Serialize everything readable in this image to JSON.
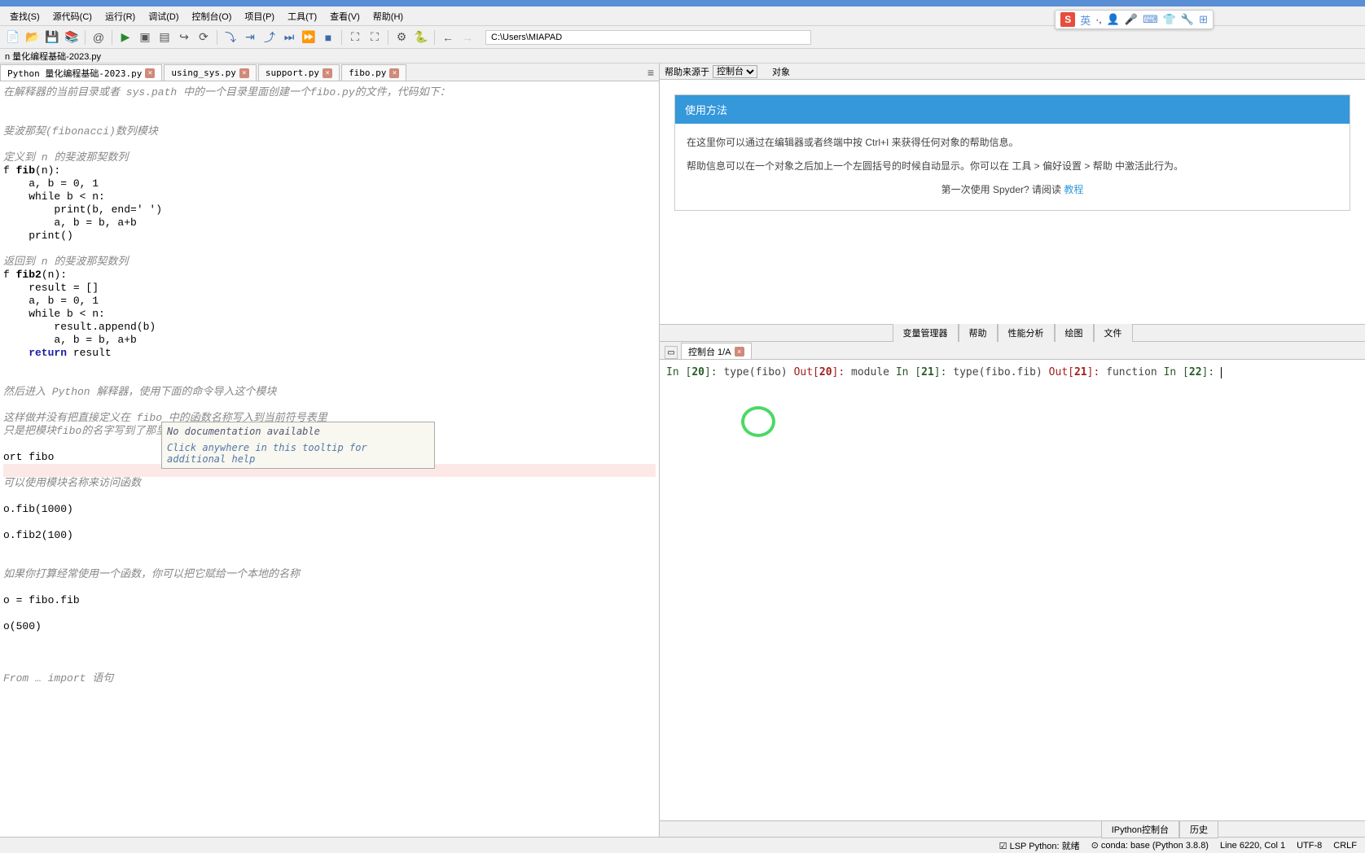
{
  "title_fragment": ".8)",
  "menu": [
    "查找(S)",
    "源代码(C)",
    "运行(R)",
    "调试(D)",
    "控制台(O)",
    "项目(P)",
    "工具(T)",
    "查看(V)",
    "帮助(H)"
  ],
  "path": "C:\\Users\\MIAPAD",
  "breadcrumb": "n 量化编程基础-2023.py",
  "tabs": [
    {
      "label": "Python 量化编程基础-2023.py",
      "active": true
    },
    {
      "label": "using_sys.py",
      "active": false
    },
    {
      "label": "support.py",
      "active": false
    },
    {
      "label": "fibo.py",
      "active": false
    }
  ],
  "editor": {
    "l1": "在解释器的当前目录或者 sys.path 中的一个目录里面创建一个fibo.py的文件，代码如下：",
    "l2": "斐波那契(fibonacci)数列模块",
    "l3": "定义到 n 的斐波那契数列",
    "fib_def": "fib",
    "fib_arg": "(n):",
    "body1": "    a, b = 0, 1",
    "body2": "    while b < n:",
    "body3": "        print(b, end=' ')",
    "body4": "        a, b = b, a+b",
    "body5": "    print()",
    "l4": "返回到 n 的斐波那契数列",
    "fib2_def": "fib2",
    "fib2_arg": "(n):",
    "body6": "    result = []",
    "body7": "    a, b = 0, 1",
    "body8": "    while b < n:",
    "body9": "        result.append(b)",
    "body10": "        a, b = b, a+b",
    "body11": "    return result",
    "l5": "然后进入 Python 解释器，使用下面的命令导入这个模块",
    "l6": "这样做并没有把直接定义在 fibo 中的函数名称写入到当前符号表里",
    "l7": "只是把模块fibo的名字写到了那里",
    "imp": "ort fibo",
    "l8": "可以使用模块名称来访问函数",
    "c1": "o.fib(1000)",
    "c2": "o.fib2(100)",
    "l9": "如果你打算经常使用一个函数，你可以把它赋给一个本地的名称",
    "c3": "o = fibo.fib",
    "c4": "o(500)",
    "l10": "From … import 语句"
  },
  "tooltip": {
    "line1": "No documentation available",
    "line2": "Click anywhere in this tooltip for additional help"
  },
  "help": {
    "source_label": "帮助来源于",
    "source_value": "控制台",
    "object_label": "对象",
    "title": "使用方法",
    "p1": "在这里你可以通过在编辑器或者终端中按 Ctrl+I 来获得任何对象的帮助信息。",
    "p2": "帮助信息可以在一个对象之后加上一个左圆括号的时候自动显示。你可以在 工具 > 偏好设置 > 帮助 中激活此行为。",
    "p3_prefix": "第一次使用 Spyder? 请阅读 ",
    "p3_link": "教程"
  },
  "right_tabs": [
    "变量管理器",
    "帮助",
    "性能分析",
    "绘图",
    "文件"
  ],
  "console": {
    "tab": "控制台 1/A",
    "in20": "In [20]: ",
    "in20_code": "type(fibo)",
    "out20": "Out[20]: ",
    "out20_val": "module",
    "in21": "In [21]: ",
    "in21_code": "type(fibo.fib)",
    "out21": "Out[21]: ",
    "out21_val": "function",
    "in22": "In [22]: "
  },
  "bottom_tabs": [
    "IPython控制台",
    "历史"
  ],
  "status": {
    "lsp": "☑ LSP Python: 就绪",
    "conda": "⊙ conda: base (Python 3.8.8)",
    "line": "Line 6220, Col 1",
    "enc": "UTF-8",
    "eol": "CRLF"
  },
  "ime": {
    "logo": "S",
    "lang": "英"
  }
}
